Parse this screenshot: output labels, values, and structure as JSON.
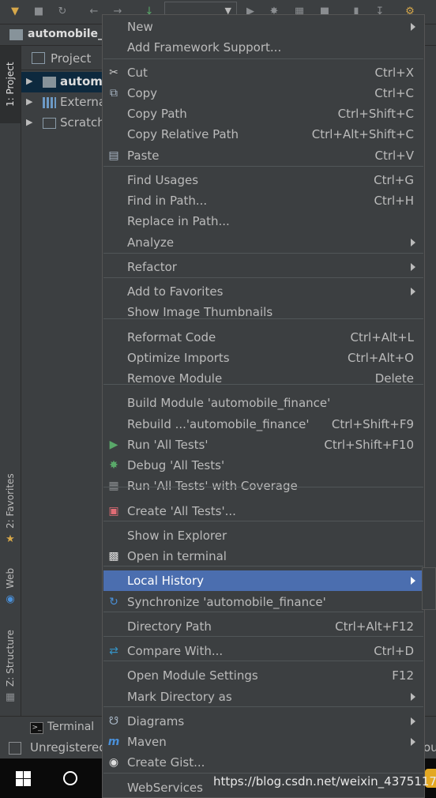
{
  "breadcrumb": {
    "project": "automobile_"
  },
  "project_panel": {
    "title": "Project",
    "tree": [
      {
        "label": "automobile_finance",
        "selected": true
      },
      {
        "label": "External Libraries",
        "selected": false
      },
      {
        "label": "Scratches and Consoles",
        "selected": false
      }
    ]
  },
  "left_strip": {
    "project_tab": "1: Project",
    "favorites_tab": "2: Favorites",
    "web_tab": "Web",
    "structure_tab": "Z: Structure"
  },
  "bottom": {
    "terminal": "Terminal",
    "status": "Unregistered",
    "status_right": "ou"
  },
  "menu": {
    "items": [
      {
        "label": "New",
        "shortcut": "",
        "submenu": true,
        "icon": ""
      },
      {
        "label": "Add Framework Support...",
        "shortcut": "",
        "submenu": false,
        "icon": ""
      },
      {
        "label": "Cut",
        "shortcut": "Ctrl+X",
        "submenu": false,
        "icon": "scissors-icon"
      },
      {
        "label": "Copy",
        "shortcut": "Ctrl+C",
        "submenu": false,
        "icon": "copy-icon"
      },
      {
        "label": "Copy Path",
        "shortcut": "Ctrl+Shift+C",
        "submenu": false,
        "icon": ""
      },
      {
        "label": "Copy Relative Path",
        "shortcut": "Ctrl+Alt+Shift+C",
        "submenu": false,
        "icon": ""
      },
      {
        "label": "Paste",
        "shortcut": "Ctrl+V",
        "submenu": false,
        "icon": "paste-icon"
      },
      {
        "label": "Find Usages",
        "shortcut": "Ctrl+G",
        "submenu": false,
        "icon": ""
      },
      {
        "label": "Find in Path...",
        "shortcut": "Ctrl+H",
        "submenu": false,
        "icon": ""
      },
      {
        "label": "Replace in Path...",
        "shortcut": "",
        "submenu": false,
        "icon": ""
      },
      {
        "label": "Analyze",
        "shortcut": "",
        "submenu": true,
        "icon": ""
      },
      {
        "label": "Refactor",
        "shortcut": "",
        "submenu": true,
        "icon": ""
      },
      {
        "label": "Add to Favorites",
        "shortcut": "",
        "submenu": true,
        "icon": ""
      },
      {
        "label": "Show Image Thumbnails",
        "shortcut": "",
        "submenu": false,
        "icon": ""
      },
      {
        "label": "Reformat Code",
        "shortcut": "Ctrl+Alt+L",
        "submenu": false,
        "icon": ""
      },
      {
        "label": "Optimize Imports",
        "shortcut": "Ctrl+Alt+O",
        "submenu": false,
        "icon": ""
      },
      {
        "label": "Remove Module",
        "shortcut": "Delete",
        "submenu": false,
        "icon": ""
      },
      {
        "label": "Build Module 'automobile_finance'",
        "shortcut": "",
        "submenu": false,
        "icon": ""
      },
      {
        "label": "Rebuild ...'automobile_finance'",
        "shortcut": "Ctrl+Shift+F9",
        "submenu": false,
        "icon": ""
      },
      {
        "label": "Run 'All Tests'",
        "shortcut": "Ctrl+Shift+F10",
        "submenu": false,
        "icon": "run-icon"
      },
      {
        "label": "Debug 'All Tests'",
        "shortcut": "",
        "submenu": false,
        "icon": "debug-icon"
      },
      {
        "label": "Run 'All Tests' with Coverage",
        "shortcut": "",
        "submenu": false,
        "icon": "coverage-icon"
      },
      {
        "label": "Create 'All Tests'...",
        "shortcut": "",
        "submenu": false,
        "icon": "create-test-icon"
      },
      {
        "label": "Show in Explorer",
        "shortcut": "",
        "submenu": false,
        "icon": ""
      },
      {
        "label": "Open in terminal",
        "shortcut": "",
        "submenu": false,
        "icon": "terminal-icon"
      },
      {
        "label": "Local History",
        "shortcut": "",
        "submenu": true,
        "icon": ""
      },
      {
        "label": "Synchronize 'automobile_finance'",
        "shortcut": "",
        "submenu": false,
        "icon": "sync-icon"
      },
      {
        "label": "Directory Path",
        "shortcut": "Ctrl+Alt+F12",
        "submenu": false,
        "icon": ""
      },
      {
        "label": "Compare With...",
        "shortcut": "Ctrl+D",
        "submenu": false,
        "icon": "compare-icon"
      },
      {
        "label": "Open Module Settings",
        "shortcut": "F12",
        "submenu": false,
        "icon": ""
      },
      {
        "label": "Mark Directory as",
        "shortcut": "",
        "submenu": true,
        "icon": ""
      },
      {
        "label": "Diagrams",
        "shortcut": "",
        "submenu": true,
        "icon": "diagrams-icon"
      },
      {
        "label": "Maven",
        "shortcut": "",
        "submenu": true,
        "icon": "maven-icon"
      },
      {
        "label": "Create Gist...",
        "shortcut": "",
        "submenu": false,
        "icon": "github-icon"
      },
      {
        "label": "WebServices",
        "shortcut": "",
        "submenu": false,
        "icon": ""
      }
    ],
    "highlighted": "Local History"
  },
  "watermark": "https://blog.csdn.net/weixin_43751173",
  "colors": {
    "menu_bg": "#3c3f41",
    "highlight": "#4b6eaf",
    "selection": "#0d293e",
    "run_green": "#59a869"
  }
}
